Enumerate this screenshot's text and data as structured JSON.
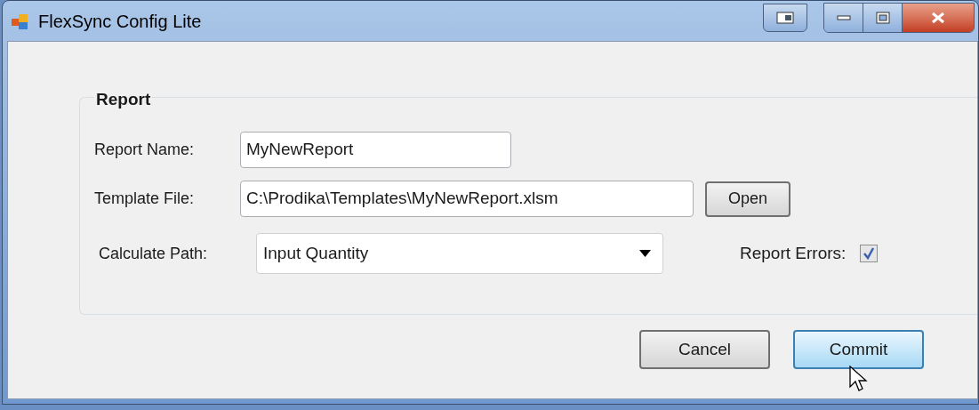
{
  "window": {
    "title": "FlexSync Config Lite"
  },
  "group": {
    "title": "Report"
  },
  "fields": [
    {
      "label": "Report Name:",
      "value": "MyNewReport"
    },
    {
      "label": "Template File:",
      "value": "C:\\Prodika\\Templates\\MyNewReport.xlsm",
      "button": "Open"
    }
  ],
  "calculate_path": {
    "label": "Calculate Path:",
    "value": "Input Quantity"
  },
  "report_errors": {
    "label": "Report Errors:",
    "checked": true
  },
  "buttons": [
    {
      "label": "Cancel",
      "hovered": false
    },
    {
      "label": "Commit",
      "hovered": true
    }
  ]
}
